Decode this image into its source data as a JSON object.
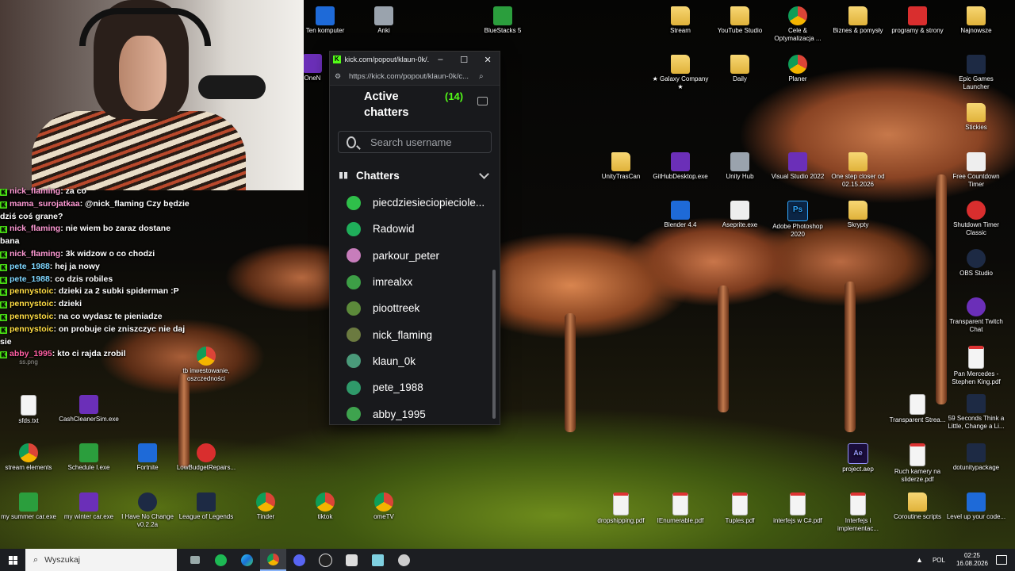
{
  "desktop_icons": [
    {
      "label": "Ten komputer",
      "icon": "computer-icon"
    },
    {
      "label": "Anki",
      "icon": "anki-icon"
    },
    {
      "label": "BlueStacks 5",
      "icon": "bluestacks-icon"
    },
    {
      "label": "Stream",
      "icon": "folder-icon"
    },
    {
      "label": "YouTube Studio",
      "icon": "folder-icon"
    },
    {
      "label": "Cele & Optymalizacja ...",
      "icon": "chrome-icon"
    },
    {
      "label": "Biznes & pomysły",
      "icon": "folder-icon"
    },
    {
      "label": "programy & strony",
      "icon": "folder-icon"
    },
    {
      "label": "Najnowsze",
      "icon": "folder-icon"
    },
    {
      "label": "OneN",
      "icon": "onenote-icon"
    },
    {
      "label": "★ Galaxy Company ★",
      "icon": "folder-icon"
    },
    {
      "label": "Daily",
      "icon": "folder-icon"
    },
    {
      "label": "Planer",
      "icon": "chrome-icon"
    },
    {
      "label": "Epic Games Launcher",
      "icon": "epic-icon"
    },
    {
      "label": "Stickies",
      "icon": "stickies-icon"
    },
    {
      "label": "UnityTrasCan",
      "icon": "folder-icon"
    },
    {
      "label": "GitHubDesktop.exe",
      "icon": "github-icon"
    },
    {
      "label": "Unity Hub",
      "icon": "unity-icon"
    },
    {
      "label": "Visual Studio 2022",
      "icon": "vs-icon"
    },
    {
      "label": "One step closer od 02.15.2026",
      "icon": "folder-icon"
    },
    {
      "label": "Free Countdown Timer",
      "icon": "timer-icon"
    },
    {
      "label": "Blender 4.4",
      "icon": "blender-icon"
    },
    {
      "label": "Aseprite.exe",
      "icon": "aseprite-icon"
    },
    {
      "label": "Adobe Photoshop 2020",
      "icon": "photoshop-icon"
    },
    {
      "label": "Skrypty",
      "icon": "folder-icon"
    },
    {
      "label": "Shutdown Timer Classic",
      "icon": "shutdown-icon"
    },
    {
      "label": "OBS Studio",
      "icon": "obs-icon"
    },
    {
      "label": "Transparent Twitch Chat",
      "icon": "twitch-chat-icon"
    },
    {
      "label": "Pan Mercedes - Stephen King.pdf",
      "icon": "pdf-icon"
    },
    {
      "label": "Transparent Strea...",
      "icon": "file-icon"
    },
    {
      "label": "59 Seconds Think a Little, Change a Li...",
      "icon": "pdf-icon"
    },
    {
      "label": "tb inwestowanie, oszczedności",
      "icon": "chrome-icon"
    },
    {
      "label": "ss.png",
      "icon": "image-icon"
    },
    {
      "label": "sfds.txt",
      "icon": "text-file-icon"
    },
    {
      "label": "CashCleanerSim.exe",
      "icon": "game-icon"
    },
    {
      "label": "stream elements",
      "icon": "chrome-icon"
    },
    {
      "label": "Schedule I.exe",
      "icon": "game-icon"
    },
    {
      "label": "Fortnite",
      "icon": "fortnite-icon"
    },
    {
      "label": "LowBudgetRepairs...",
      "icon": "game-icon"
    },
    {
      "label": "project.aep",
      "icon": "after-effects-icon"
    },
    {
      "label": "Ruch kamery na sliderze.pdf",
      "icon": "pdf-icon"
    },
    {
      "label": "dotunitypackage",
      "icon": "unity-package-icon"
    },
    {
      "label": "my summer car.exe",
      "icon": "game-icon"
    },
    {
      "label": "my winter car.exe",
      "icon": "game-icon"
    },
    {
      "label": "I Have No Change v0.2.2a",
      "icon": "unreal-icon"
    },
    {
      "label": "League of Legends",
      "icon": "lol-icon"
    },
    {
      "label": "Tinder",
      "icon": "chrome-icon"
    },
    {
      "label": "tiktok",
      "icon": "chrome-icon"
    },
    {
      "label": "omeTV",
      "icon": "chrome-icon"
    },
    {
      "label": "dropshipping.pdf",
      "icon": "pdf-icon"
    },
    {
      "label": "IEnumerable.pdf",
      "icon": "pdf-icon"
    },
    {
      "label": "Tuples.pdf",
      "icon": "pdf-icon"
    },
    {
      "label": "interfejs w C#.pdf",
      "icon": "pdf-icon"
    },
    {
      "label": "Interfejs i implementac...",
      "icon": "pdf-icon"
    },
    {
      "label": "Coroutine scripts",
      "icon": "folder-icon"
    },
    {
      "label": "Level up your code...",
      "icon": "file-icon"
    }
  ],
  "chat_overlay": [
    {
      "user": "nick_flaming",
      "text": "za co",
      "color": "pink"
    },
    {
      "user": "mama_surojatkaa",
      "text": "@nick_flaming Czy będzie dziś coś grane?",
      "color": "pink"
    },
    {
      "user": "nick_flaming",
      "text": "nie wiem bo zaraz dostane bana",
      "color": "pink"
    },
    {
      "user": "nick_flaming",
      "text": "3k widzow o co chodzi",
      "color": "pink"
    },
    {
      "user": "pete_1988",
      "text": "hej ja nowy",
      "color": "blue"
    },
    {
      "user": "pete_1988",
      "text": "co dzis robiles",
      "color": "blue"
    },
    {
      "user": "pennystoic",
      "text": "dzieki za 2 subki spiderman :P",
      "color": "yellow"
    },
    {
      "user": "pennystoic",
      "text": "dzieki",
      "color": "yellow"
    },
    {
      "user": "pennystoic",
      "text": "na co wydasz te pieniadze",
      "color": "yellow"
    },
    {
      "user": "pennystoic",
      "text": "on probuje cie zniszczyc nie daj sie",
      "color": "yellow"
    },
    {
      "user": "abby_1995",
      "text": "kto ci rajda zrobil",
      "color": "magenta"
    }
  ],
  "popout": {
    "tab_title": "kick.com/popout/klaun-0k/...",
    "url": "https://kick.com/popout/klaun-0k/c...",
    "heading_line1": "Active",
    "heading_line2": "chatters",
    "count": "(14)",
    "search_placeholder": "Search username",
    "section_label": "Chatters",
    "users": [
      {
        "name": "piecdziesieciopieciole...",
        "avatar_color": "#2fbf4a"
      },
      {
        "name": "Radowid",
        "avatar_color": "#1fae5a"
      },
      {
        "name": "parkour_peter",
        "avatar_color": "#c77dbb"
      },
      {
        "name": "imrealxx",
        "avatar_color": "#3d9e46"
      },
      {
        "name": "pioottreek",
        "avatar_color": "#5c8a3a"
      },
      {
        "name": "nick_flaming",
        "avatar_color": "#6b7a40"
      },
      {
        "name": "klaun_0k",
        "avatar_color": "#4a9a7a"
      },
      {
        "name": "pete_1988",
        "avatar_color": "#2f9a6a"
      },
      {
        "name": "abby_1995",
        "avatar_color": "#3ea34e"
      }
    ]
  },
  "taskbar": {
    "search_placeholder": "Wyszukaj",
    "apps": [
      "task-view-icon",
      "spotify-icon",
      "edge-icon",
      "chrome-icon",
      "discord-icon",
      "obs-icon",
      "game-icon",
      "stickies-icon",
      "misc-app-icon"
    ],
    "lang": "POL",
    "time": "02:25",
    "date": "16.08.2026"
  }
}
